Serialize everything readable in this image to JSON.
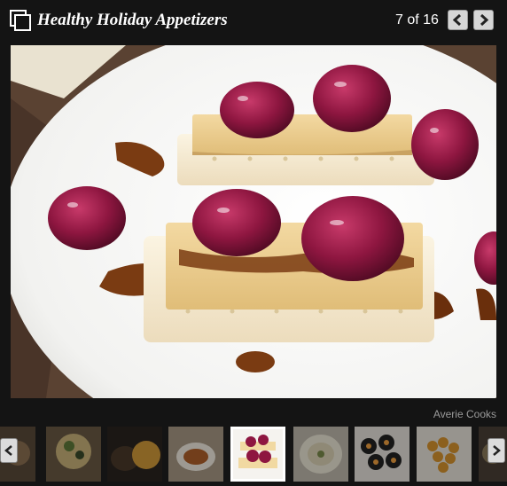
{
  "header": {
    "title": "Healthy Holiday Appetizers",
    "counter": "7 of 16",
    "prev_icon": "chevron-left-icon",
    "next_icon": "chevron-right-icon",
    "gallery_icon": "gallery-icon"
  },
  "photo": {
    "credit": "Averie Cooks"
  },
  "thumbnails": {
    "count": 9,
    "selected_index": 4
  },
  "colors": {
    "background": "#141414",
    "title_text": "#ffffff",
    "credit_text": "#9a9a9a",
    "button_bg": "#d6d6d6"
  }
}
